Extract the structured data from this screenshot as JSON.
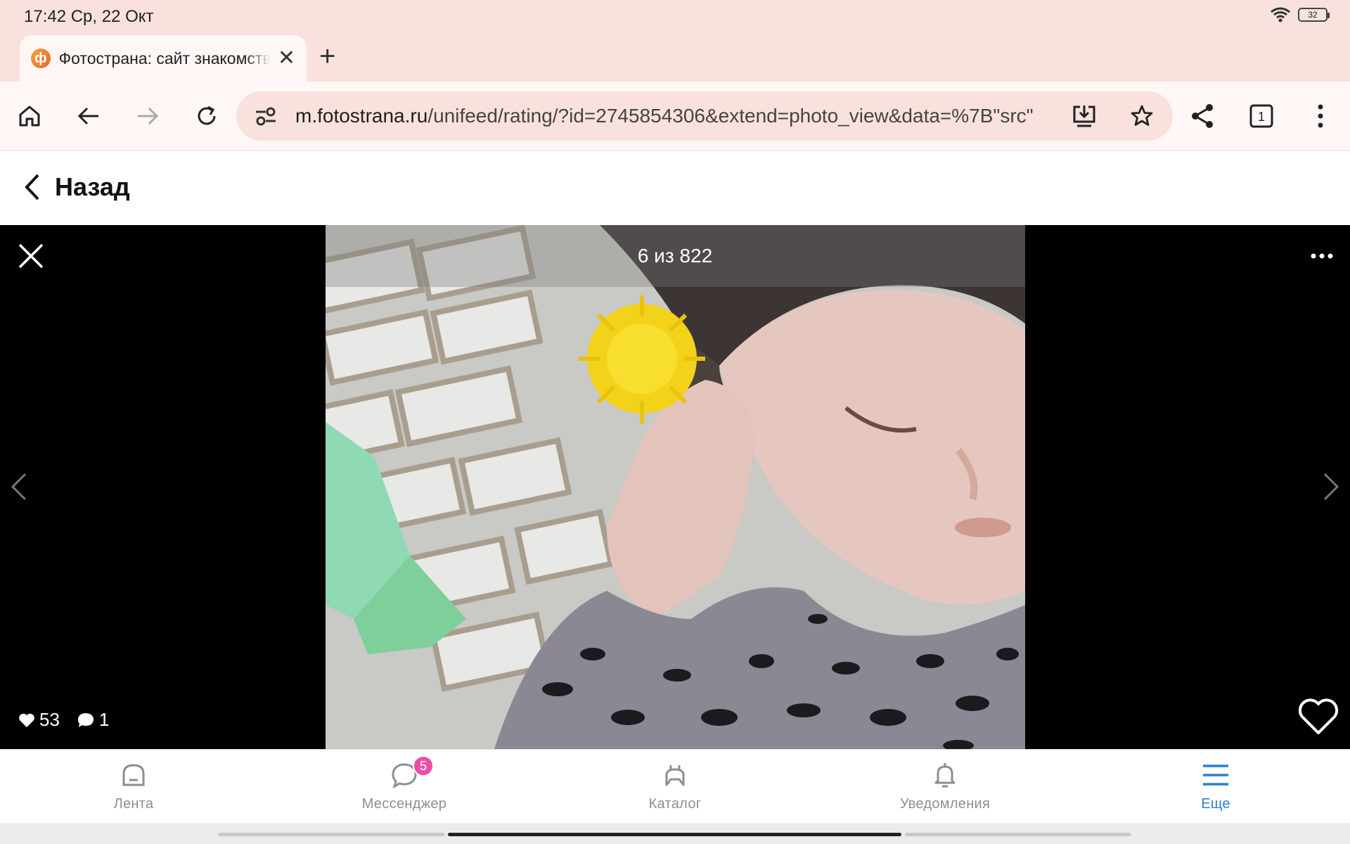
{
  "status": {
    "time": "17:42 Ср, 22 Окт",
    "battery": "32"
  },
  "tab": {
    "favicon": "ф",
    "title": "Фотострана: сайт знакомств"
  },
  "url": {
    "host": "m.fotostrana.ru",
    "path": "/unifeed/rating/?id=2745854306&extend=photo_view&data=%7B\"src\""
  },
  "header": {
    "back_label": "Назад"
  },
  "viewer": {
    "counter": "6 из 822",
    "likes": "53",
    "comments": "1"
  },
  "nav": {
    "items": [
      {
        "label": "Лента",
        "icon": "feed-icon"
      },
      {
        "label": "Мессенджер",
        "icon": "chat-icon",
        "badge": "5"
      },
      {
        "label": "Каталог",
        "icon": "catalog-icon"
      },
      {
        "label": "Уведомления",
        "icon": "bell-icon"
      },
      {
        "label": "Еще",
        "icon": "menu-icon"
      }
    ]
  },
  "colors": {
    "accent": "#2b7fd4",
    "badge": "#e94fa6",
    "chrome": "#f9e1dd"
  }
}
